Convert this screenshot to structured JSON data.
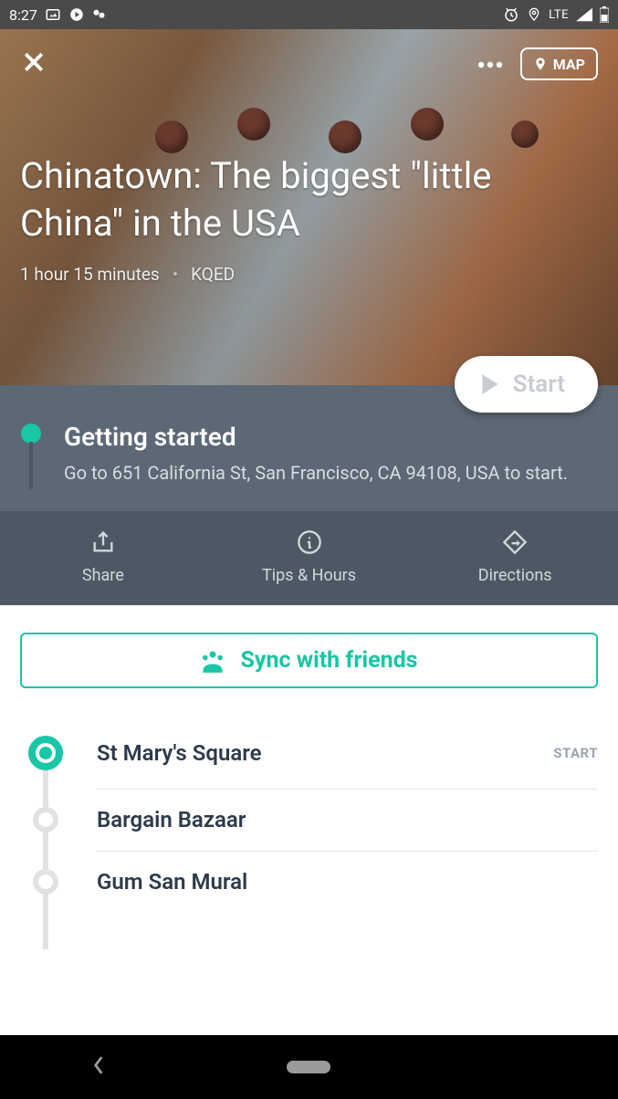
{
  "statusbar": {
    "time": "8:27",
    "network": "LTE"
  },
  "hero": {
    "title": "Chinatown: The biggest \"little China\" in the USA",
    "duration": "1 hour 15 minutes",
    "source": "KQED",
    "map_label": "MAP",
    "start_label": "Start"
  },
  "panel": {
    "heading": "Getting started",
    "body": "Go to 651 California St, San Francisco, CA 94108, USA to start."
  },
  "actions": {
    "share": "Share",
    "tips": "Tips & Hours",
    "directions": "Directions"
  },
  "sync_label": "Sync with friends",
  "stops": [
    {
      "name": "St Mary's Square",
      "tag": "START",
      "start": true
    },
    {
      "name": "Bargain Bazaar",
      "tag": "",
      "start": false
    },
    {
      "name": "Gum San Mural",
      "tag": "",
      "start": false
    }
  ]
}
